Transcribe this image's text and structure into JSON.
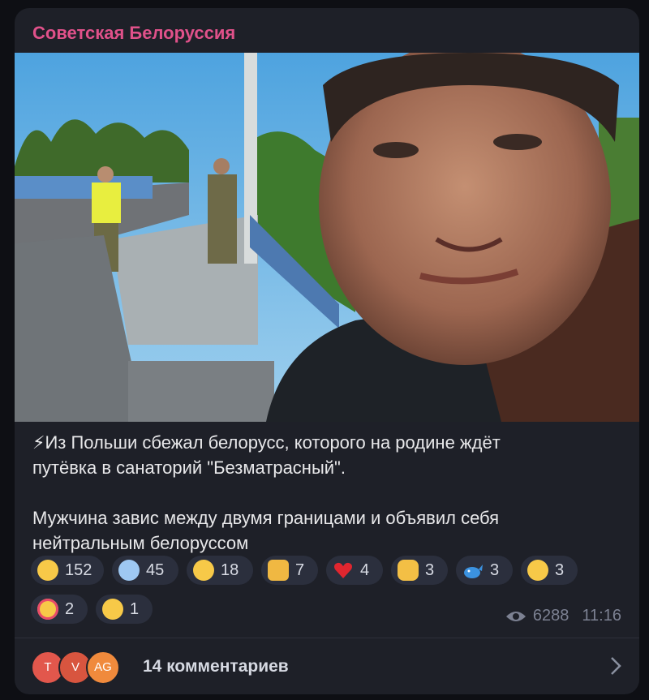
{
  "channel": {
    "name": "Советская Белоруссия"
  },
  "post": {
    "line1": "⚡Из Польши сбежал белорусс, которого на родине ждёт",
    "line2": "путёвка в санаторий \"Безматрасный\".",
    "line3": "Мужчина завис между двумя границами и объявил себя",
    "line4": "нейтральным белоруссом"
  },
  "reactions": [
    {
      "icon": "crying-face-icon",
      "count": "152"
    },
    {
      "icon": "screaming-face-icon",
      "count": "45"
    },
    {
      "icon": "loudly-crying-face-icon",
      "count": "18"
    },
    {
      "icon": "thumbs-up-icon",
      "count": "7"
    },
    {
      "icon": "red-heart-icon",
      "count": "4"
    },
    {
      "icon": "clapping-hands-icon",
      "count": "3"
    },
    {
      "icon": "whale-icon",
      "count": "3"
    },
    {
      "icon": "raised-eyebrow-face-icon",
      "count": "3"
    },
    {
      "icon": "smiling-face-with-hearts-icon",
      "count": "2"
    },
    {
      "icon": "grinning-face-icon",
      "count": "1"
    }
  ],
  "meta": {
    "views": "6288",
    "time": "11:16"
  },
  "comments": {
    "avatars": [
      {
        "initial": "T",
        "color": "#e2574c"
      },
      {
        "initial": "V",
        "color": "#d8553f"
      },
      {
        "initial": "AG",
        "color": "#f08a3c"
      }
    ],
    "label": "14 комментариев"
  },
  "colors": {
    "accent": "#e0518a",
    "bubble": "#1e2028",
    "reaction_bg": "#2b2f3d"
  }
}
